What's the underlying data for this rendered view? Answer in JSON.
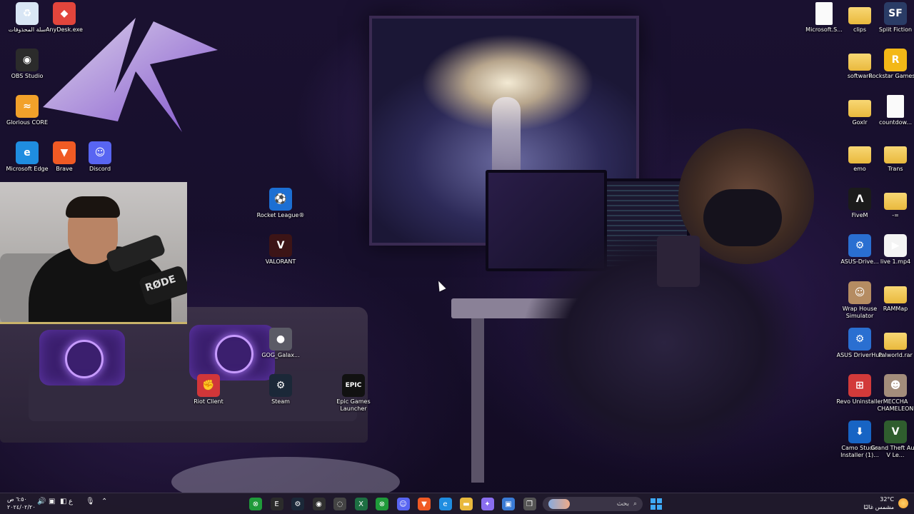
{
  "desktop": {
    "left_icons": [
      {
        "name": "recycle-bin",
        "label": "سلة المحذوفات",
        "icon": "recycle-bin-icon",
        "color": "#d9e6f5",
        "glyph": "♻"
      },
      {
        "name": "anydesk",
        "label": "AnyDesk.exe",
        "icon": "anydesk-icon",
        "color": "#e2453c",
        "glyph": "◆"
      },
      {
        "name": "obs-studio",
        "label": "OBS Studio",
        "icon": "obs-icon",
        "color": "#2b2b2b",
        "glyph": "◉"
      },
      {
        "name": "glorious-core",
        "label": "Glorious CORE",
        "icon": "glorious-icon",
        "color": "#f2a12a",
        "glyph": "≈"
      },
      {
        "name": "microsoft-edge",
        "label": "Microsoft Edge",
        "icon": "edge-icon",
        "color": "#1f8de0",
        "glyph": "e"
      },
      {
        "name": "brave",
        "label": "Brave",
        "icon": "brave-icon",
        "color": "#f05a24",
        "glyph": "▼"
      },
      {
        "name": "discord",
        "label": "Discord",
        "icon": "discord-icon",
        "color": "#5865f2",
        "glyph": "☺"
      }
    ],
    "middle_icons": [
      {
        "name": "rocket-league",
        "label": "Rocket League®",
        "icon": "rocket-league-icon",
        "color": "#1c6fd3",
        "glyph": "⚽"
      },
      {
        "name": "valorant",
        "label": "VALORANT",
        "icon": "valorant-icon",
        "color": "#3c1416",
        "glyph": "V"
      },
      {
        "name": "gog-galaxy",
        "label": "GOG_Galax...",
        "icon": "gog-galaxy-icon",
        "color": "#5b5b66",
        "glyph": "●"
      },
      {
        "name": "riot-client",
        "label": "Riot Client",
        "icon": "riot-client-icon",
        "color": "#d13639",
        "glyph": "✊"
      },
      {
        "name": "steam",
        "label": "Steam",
        "icon": "steam-icon",
        "color": "#1b2838",
        "glyph": "⚙"
      },
      {
        "name": "epic-games",
        "label": "Epic Games Launcher",
        "icon": "epic-games-icon",
        "color": "#111111",
        "glyph": "EPIC"
      }
    ],
    "right_icons": [
      {
        "name": "microsoft-s",
        "label": "Microsoft.S...",
        "icon": "document-icon",
        "type": "doc"
      },
      {
        "name": "clips",
        "label": "clips",
        "icon": "folder-icon",
        "type": "folder"
      },
      {
        "name": "split-fiction",
        "label": "Split Fiction",
        "icon": "split-fiction-icon",
        "color": "#2a3c66",
        "glyph": "SF"
      },
      {
        "name": "software",
        "label": "software",
        "icon": "folder-icon",
        "type": "folder"
      },
      {
        "name": "rockstar",
        "label": "Rockstar Games ...",
        "icon": "rockstar-icon",
        "color": "#f3b817",
        "glyph": "R"
      },
      {
        "name": "goxlr",
        "label": "Goxlr",
        "icon": "folder-icon",
        "type": "folder"
      },
      {
        "name": "countdown",
        "label": "countdow...",
        "icon": "document-icon",
        "type": "doc"
      },
      {
        "name": "emo",
        "label": "emo",
        "icon": "folder-icon",
        "type": "folder"
      },
      {
        "name": "trans",
        "label": "Trans",
        "icon": "folder-icon",
        "type": "folder"
      },
      {
        "name": "fivem",
        "label": "FiveM",
        "icon": "fivem-icon",
        "color": "#1b1b1b",
        "glyph": "Λ"
      },
      {
        "name": "dash-folder",
        "label": "-=",
        "icon": "folder-icon",
        "type": "folder"
      },
      {
        "name": "asus-driver",
        "label": "ASUS-Drive...",
        "icon": "asus-gear-icon",
        "color": "#2a6fd1",
        "glyph": "⚙"
      },
      {
        "name": "live-mp4",
        "label": "live 1.mp4",
        "icon": "video-file-icon",
        "color": "#f4f4f4",
        "glyph": "▶"
      },
      {
        "name": "wrap-house",
        "label": "Wrap House Simulator",
        "icon": "wrap-house-icon",
        "color": "#b58c62",
        "glyph": "☺"
      },
      {
        "name": "rammap",
        "label": "RAMMap",
        "icon": "folder-icon",
        "type": "folder"
      },
      {
        "name": "asus-driverhub",
        "label": "ASUS DriverHub",
        "icon": "asus-gear-icon",
        "color": "#2a6fd1",
        "glyph": "⚙"
      },
      {
        "name": "palworld",
        "label": "Palworld.rar",
        "icon": "archive-folder-icon",
        "type": "folder"
      },
      {
        "name": "revo",
        "label": "Revo Uninstaller",
        "icon": "revo-icon",
        "color": "#d23a3a",
        "glyph": "⊞"
      },
      {
        "name": "meccha",
        "label": "MECCHA CHAMELEON",
        "icon": "meccha-icon",
        "color": "#a38d7b",
        "glyph": "☻"
      },
      {
        "name": "camo-studio",
        "label": "Camo Studio Installer (1)...",
        "icon": "camo-download-icon",
        "color": "#1764c4",
        "glyph": "⬇"
      },
      {
        "name": "gta-v",
        "label": "Grand Theft Auto V Le...",
        "icon": "gta-v-icon",
        "color": "#2f5d2e",
        "glyph": "V"
      }
    ]
  },
  "taskbar": {
    "clock_time": "٦:٥٠ ص",
    "clock_date": "٢٠٢٤/٠٢/٢٠",
    "language": "ع",
    "search_placeholder": "بحث",
    "weather_temp": "32°C",
    "weather_desc": "مشمس غالبًا",
    "apps": [
      {
        "name": "xbox-app",
        "icon": "xbox-icon",
        "color": "#1f9a3a",
        "glyph": "⊗"
      },
      {
        "name": "epic-taskbar",
        "icon": "epic-games-icon",
        "color": "#2b2b2b",
        "glyph": "E"
      },
      {
        "name": "steam-taskbar",
        "icon": "steam-icon",
        "color": "#1b2838",
        "glyph": "⚙"
      },
      {
        "name": "obs-taskbar",
        "icon": "obs-icon",
        "color": "#303030",
        "glyph": "◉"
      },
      {
        "name": "nzxt-taskbar",
        "icon": "nzxt-icon",
        "color": "#444",
        "glyph": "◌"
      },
      {
        "name": "excel-taskbar",
        "icon": "excel-icon",
        "color": "#1d6f42",
        "glyph": "X"
      },
      {
        "name": "xbox-taskbar-2",
        "icon": "xbox-icon",
        "color": "#1f9a3a",
        "glyph": "⊗"
      },
      {
        "name": "discord-taskbar",
        "icon": "discord-icon",
        "color": "#5865f2",
        "glyph": "☺"
      },
      {
        "name": "brave-taskbar",
        "icon": "brave-icon",
        "color": "#f05a24",
        "glyph": "▼"
      },
      {
        "name": "edge-taskbar",
        "icon": "edge-icon",
        "color": "#1f8de0",
        "glyph": "e"
      },
      {
        "name": "file-explorer-taskbar",
        "icon": "folder-icon",
        "color": "#e9b93d",
        "glyph": "▬"
      },
      {
        "name": "copilot-taskbar",
        "icon": "copilot-icon",
        "color": "#8a6ef0",
        "glyph": "✦"
      },
      {
        "name": "store-taskbar",
        "icon": "store-icon",
        "color": "#3a7bd5",
        "glyph": "▣"
      },
      {
        "name": "task-view-taskbar",
        "icon": "task-view-icon",
        "color": "#555",
        "glyph": "❐"
      }
    ]
  }
}
